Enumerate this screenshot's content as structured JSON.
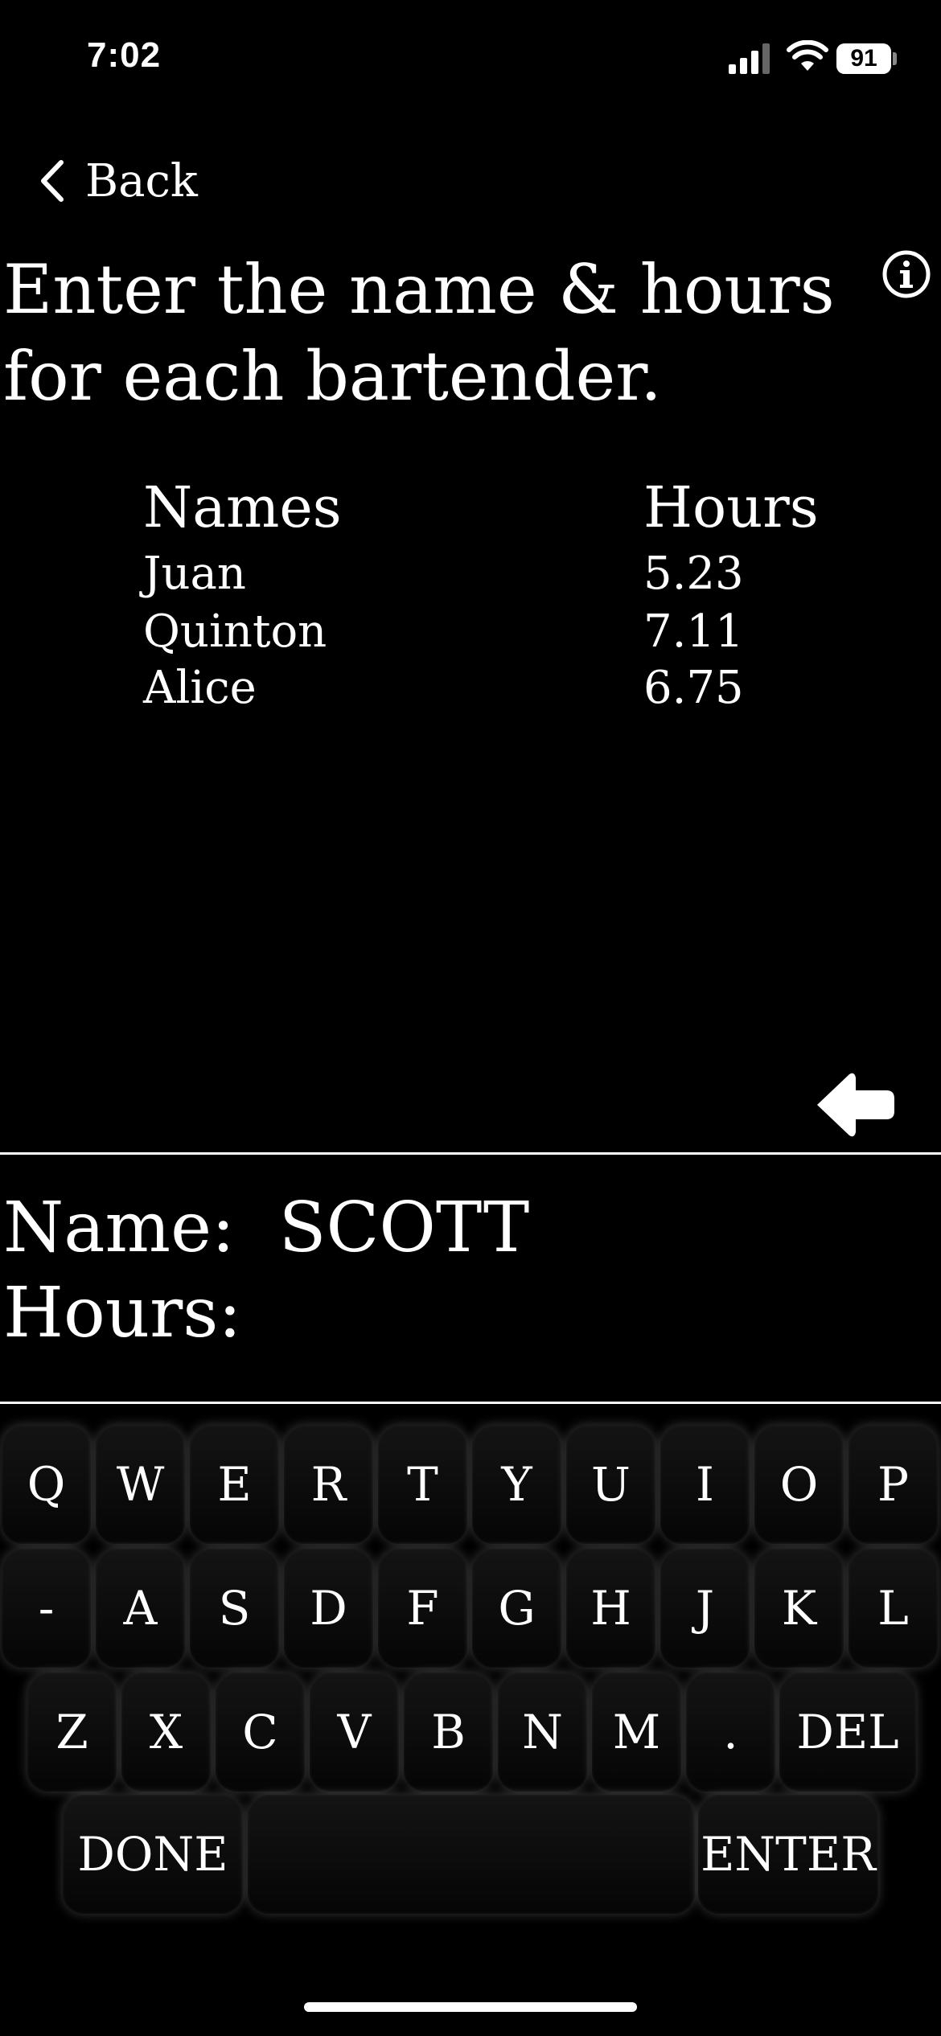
{
  "status": {
    "time": "7:02",
    "battery": "91"
  },
  "nav": {
    "back_label": "Back"
  },
  "title": "Enter the name & hours for each bartender.",
  "table": {
    "headers": {
      "names": "Names",
      "hours": "Hours"
    },
    "rows": [
      {
        "name": "Juan",
        "hours": "5.23"
      },
      {
        "name": "Quinton",
        "hours": "7.11"
      },
      {
        "name": "Alice",
        "hours": "6.75"
      }
    ]
  },
  "entry": {
    "name_label": "Name:",
    "name_value": "SCOTT",
    "hours_label": "Hours:",
    "hours_value": ""
  },
  "keyboard": {
    "row1": [
      "Q",
      "W",
      "E",
      "R",
      "T",
      "Y",
      "U",
      "I",
      "O",
      "P"
    ],
    "row2": [
      "-",
      "A",
      "S",
      "D",
      "F",
      "G",
      "H",
      "J",
      "K",
      "L"
    ],
    "row3": [
      "Z",
      "X",
      "C",
      "V",
      "B",
      "N",
      "M",
      "."
    ],
    "delete_label": "DEL",
    "done_label": "DONE",
    "space_label": "",
    "enter_label": "ENTER"
  },
  "icons": {
    "back": "chevron-left-icon",
    "info": "info-icon",
    "backspace": "arrow-left-icon"
  }
}
